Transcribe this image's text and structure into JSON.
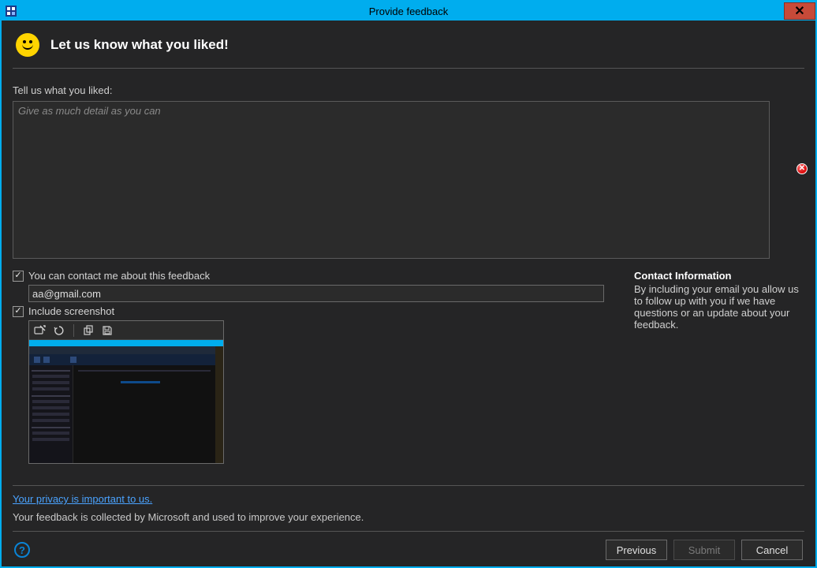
{
  "window": {
    "title": "Provide feedback"
  },
  "header": {
    "heading": "Let us know what you liked!"
  },
  "form": {
    "prompt_label": "Tell us what you liked:",
    "feedback_placeholder": "Give as much detail as you can",
    "feedback_value": "",
    "contact_me": {
      "checked": true,
      "label": "You can contact me about this feedback"
    },
    "email_value": "aa@gmail.com",
    "include_screenshot": {
      "checked": true,
      "label": "Include screenshot"
    }
  },
  "contact_info": {
    "title": "Contact Information",
    "text": "By including your email you allow us to follow up with you if we have questions or an update about your feedback."
  },
  "footer": {
    "privacy_link": "Your privacy is important to us.",
    "collected_text": "Your feedback is collected by Microsoft and used to improve your experience."
  },
  "buttons": {
    "previous": "Previous",
    "submit": "Submit",
    "cancel": "Cancel"
  },
  "screenshot_tools": {
    "annotate": "annotate",
    "reset": "reset",
    "copy": "copy",
    "save": "save"
  }
}
